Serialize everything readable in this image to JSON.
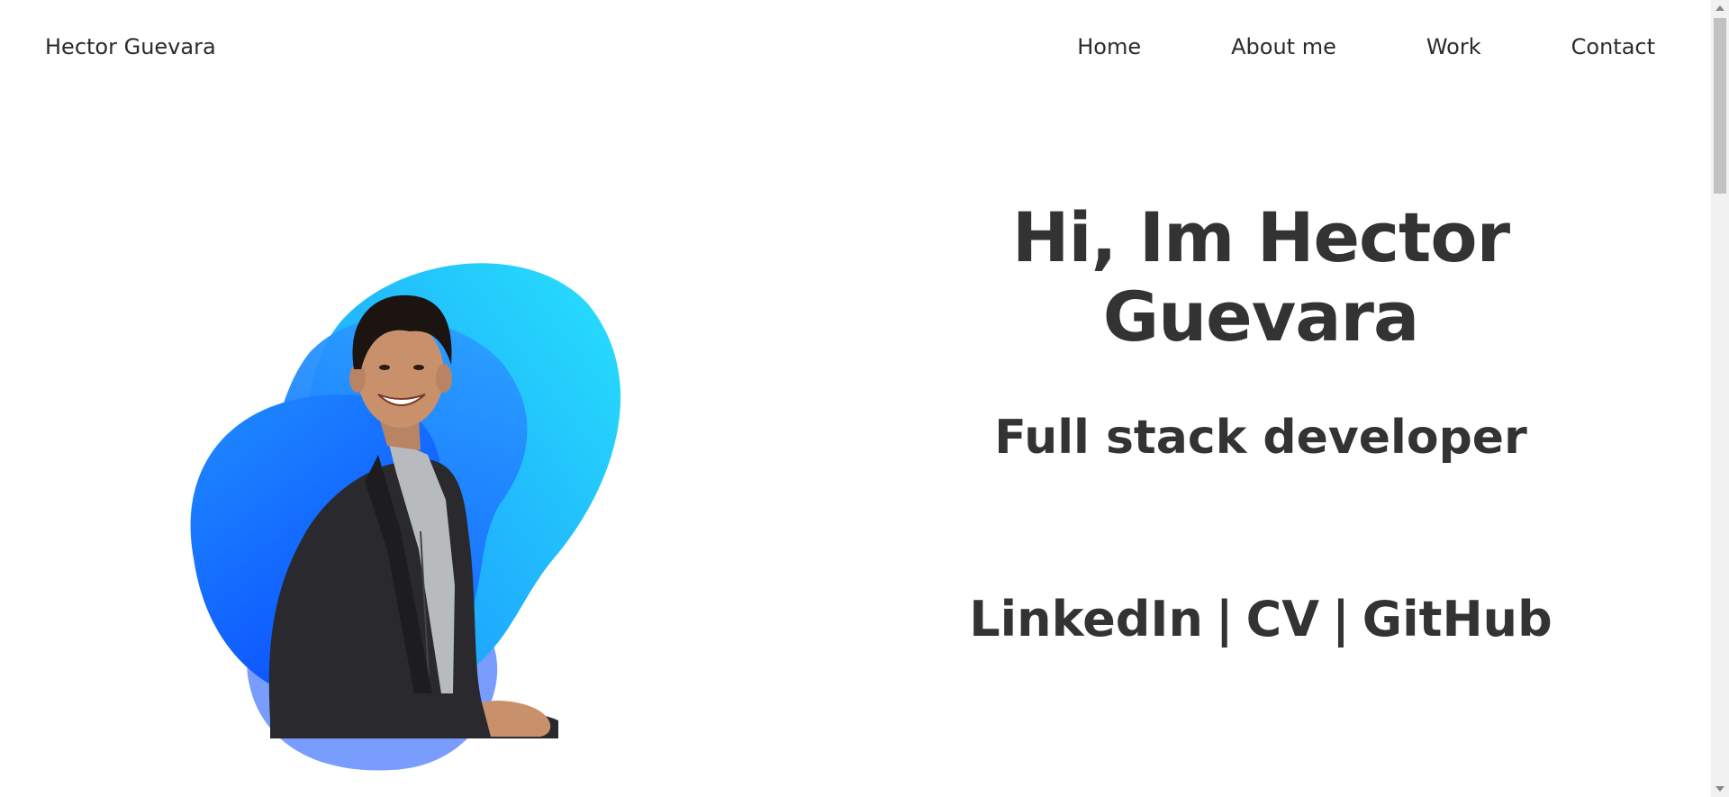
{
  "brand": {
    "name": "Hector Guevara"
  },
  "nav": {
    "items": [
      {
        "label": "Home"
      },
      {
        "label": "About me"
      },
      {
        "label": "Work"
      },
      {
        "label": "Contact"
      }
    ]
  },
  "hero": {
    "title_line1": "Hi, Im Hector",
    "title_line2": "Guevara",
    "subtitle": "Full stack developer",
    "links": {
      "linkedin": "LinkedIn",
      "cv": "CV",
      "github": "GitHub",
      "separator": "|"
    }
  },
  "colors": {
    "text": "#333333",
    "blob_light": "#26d7fb",
    "blob_mid": "#1a8cff",
    "blob_deep": "#0a4dff",
    "suit": "#2a2a2e",
    "shirt": "#b7babd",
    "skin": "#c8916b",
    "hair": "#1b1410"
  }
}
